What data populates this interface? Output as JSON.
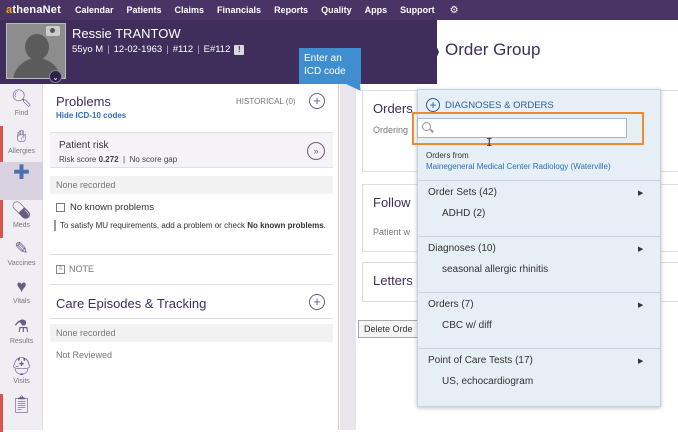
{
  "app": {
    "logo_prefix": "",
    "logo_accent": "a",
    "logo_suffix": "thenaNet"
  },
  "nav": {
    "items": [
      "Calendar",
      "Patients",
      "Claims",
      "Financials",
      "Reports",
      "Quality",
      "Apps",
      "Support"
    ],
    "gear_icon": "gear-icon"
  },
  "patient": {
    "name": "Ressie TRANTOW",
    "age_sex": "55yo M",
    "dob": "12-02-1963",
    "id": "#112",
    "eid": "E#112",
    "alert_glyph": "!"
  },
  "page": {
    "title": "Order Group"
  },
  "tooltip": {
    "text": "Enter an ICD code"
  },
  "sidebar": {
    "items": [
      {
        "label": "Find",
        "icon": "search-icon"
      },
      {
        "label": "Allergies",
        "icon": "hand-icon"
      },
      {
        "label": "",
        "icon": "cross-icon"
      },
      {
        "label": "Meds",
        "icon": "pills-icon"
      },
      {
        "label": "Vaccines",
        "icon": "syringe-icon"
      },
      {
        "label": "Vitals",
        "icon": "heart-icon"
      },
      {
        "label": "Results",
        "icon": "flask-icon"
      },
      {
        "label": "Visits",
        "icon": "medkit-icon"
      },
      {
        "label": "",
        "icon": "clipboard-icon"
      }
    ]
  },
  "problems": {
    "title": "Problems",
    "hide_link": "Hide ICD-10 codes",
    "historical": "HISTORICAL (0)",
    "risk_title": "Patient risk",
    "risk_score_label": "Risk score",
    "risk_score_value": "0.272",
    "risk_gap": "No score gap",
    "none_recorded": "None recorded",
    "no_known_label": "No known problems",
    "mu_note_prefix": "To satisfy MU requirements, add a problem or check ",
    "mu_note_bold": "No known problems",
    "mu_note_suffix": ".",
    "note_label": "NOTE",
    "care_title": "Care Episodes & Tracking",
    "care_none": "None recorded",
    "not_reviewed": "Not Reviewed"
  },
  "main": {
    "orders_title": "Orders",
    "ordering_label": "Ordering",
    "follow_title": "Follow",
    "patient_label": "Patient w",
    "letters_title": "Letters",
    "delete_label": "Delete Orde"
  },
  "dropdown": {
    "header": "DIAGNOSES & ORDERS",
    "search_value": "",
    "orders_from_label": "Orders from",
    "orders_from_facility": "Mainegeneral Medical Center Radiology (Waterville)",
    "categories": [
      {
        "label": "Order Sets (42)",
        "item": "ADHD (2)"
      },
      {
        "label": "Diagnoses (10)",
        "item": "seasonal allergic rhinitis"
      },
      {
        "label": "Orders (7)",
        "item": "CBC w/ diff"
      },
      {
        "label": "Point of Care Tests (17)",
        "item": "US, echocardiogram"
      }
    ]
  }
}
